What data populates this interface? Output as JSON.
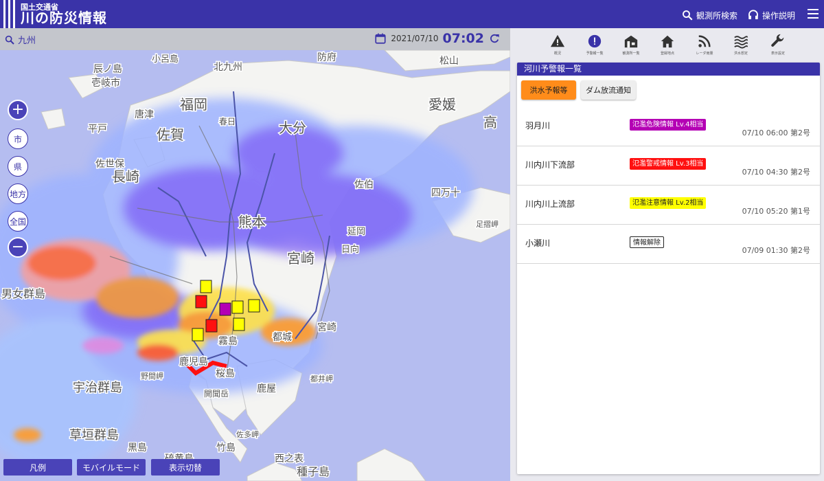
{
  "header": {
    "org": "国土交通省",
    "title": "川の防災情報",
    "search_label": "観測所検索",
    "help_label": "操作説明"
  },
  "map": {
    "region": "九州",
    "date": "2021/07/10",
    "time": "07:02",
    "scale_buttons": [
      "市",
      "県",
      "地方",
      "全国"
    ],
    "bottom_buttons": [
      "凡例",
      "モバイルモード",
      "表示切替"
    ],
    "place_labels": [
      {
        "text": "辰ノ島",
        "size": 14
      },
      {
        "text": "壱岐市",
        "size": 14
      },
      {
        "text": "小呂島",
        "size": 13
      },
      {
        "text": "北九州",
        "size": 14
      },
      {
        "text": "防府",
        "size": 14
      },
      {
        "text": "松山",
        "size": 14
      },
      {
        "text": "福岡",
        "size": 20
      },
      {
        "text": "唐津",
        "size": 14
      },
      {
        "text": "佐賀",
        "size": 20
      },
      {
        "text": "春日",
        "size": 12
      },
      {
        "text": "大分",
        "size": 20
      },
      {
        "text": "愛媛",
        "size": 20
      },
      {
        "text": "高",
        "size": 20
      },
      {
        "text": "平戸",
        "size": 14
      },
      {
        "text": "佐世保",
        "size": 14
      },
      {
        "text": "長崎",
        "size": 20
      },
      {
        "text": "熊本",
        "size": 20
      },
      {
        "text": "宮崎",
        "size": 20
      },
      {
        "text": "延岡",
        "size": 13
      },
      {
        "text": "日向",
        "size": 13
      },
      {
        "text": "佐伯",
        "size": 14
      },
      {
        "text": "四万十",
        "size": 14
      },
      {
        "text": "足摺岬",
        "size": 11
      },
      {
        "text": "宮崎",
        "size": 14
      },
      {
        "text": "都城",
        "size": 14
      },
      {
        "text": "霧島",
        "size": 14
      },
      {
        "text": "鹿児島",
        "size": 14
      },
      {
        "text": "桜島",
        "size": 14
      },
      {
        "text": "宇治群島",
        "size": 18
      },
      {
        "text": "野間岬",
        "size": 11
      },
      {
        "text": "鹿屋",
        "size": 14
      },
      {
        "text": "都井岬",
        "size": 11
      },
      {
        "text": "開聞岳",
        "size": 12
      },
      {
        "text": "草垣群島",
        "size": 18
      },
      {
        "text": "佐多岬",
        "size": 11
      },
      {
        "text": "竹島",
        "size": 14
      },
      {
        "text": "黒島",
        "size": 14
      },
      {
        "text": "西之表",
        "size": 14
      },
      {
        "text": "種子島",
        "size": 16
      },
      {
        "text": "硫黄島",
        "size": 14
      },
      {
        "text": "男女群島",
        "size": 16
      }
    ]
  },
  "toolbar": {
    "tools": [
      {
        "label": "概況",
        "icon": "warning-icon"
      },
      {
        "label": "予警報一覧",
        "icon": "alert-icon"
      },
      {
        "label": "観測所一覧",
        "icon": "station-list-icon"
      },
      {
        "label": "登録地点",
        "icon": "home-icon"
      },
      {
        "label": "レーダ雨量",
        "icon": "rss-icon"
      },
      {
        "label": "洪水想定",
        "icon": "waves-icon"
      },
      {
        "label": "表示設定",
        "icon": "wrench-icon"
      }
    ]
  },
  "panel": {
    "title": "河川予警報一覧",
    "filter_flood": "洪水予報等",
    "filter_dam": "ダム放流通知",
    "rows": [
      {
        "name": "羽月川",
        "badge": "氾濫危険情報 Lv.4相当",
        "badge_bg": "#b400b4",
        "badge_fg": "#ffffff",
        "time": "07/10 06:00 第2号"
      },
      {
        "name": "川内川下流部",
        "badge": "氾濫警戒情報 Lv.3相当",
        "badge_bg": "#ff1010",
        "badge_fg": "#ffffff",
        "time": "07/10 04:30 第2号"
      },
      {
        "name": "川内川上流部",
        "badge": "氾濫注意情報 Lv.2相当",
        "badge_bg": "#ffff00",
        "badge_fg": "#222222",
        "time": "07/10 05:20 第1号"
      },
      {
        "name": "小瀬川",
        "badge": "情報解除",
        "badge_bg": "#ffffff",
        "badge_fg": "#222222",
        "time": "07/09 01:30 第2号"
      }
    ]
  },
  "colors": {
    "brand": "#3a33a8",
    "accent_orange": "#ff8c1a",
    "level4": "#b400b4",
    "level3": "#ff1010",
    "level2": "#ffff00"
  }
}
